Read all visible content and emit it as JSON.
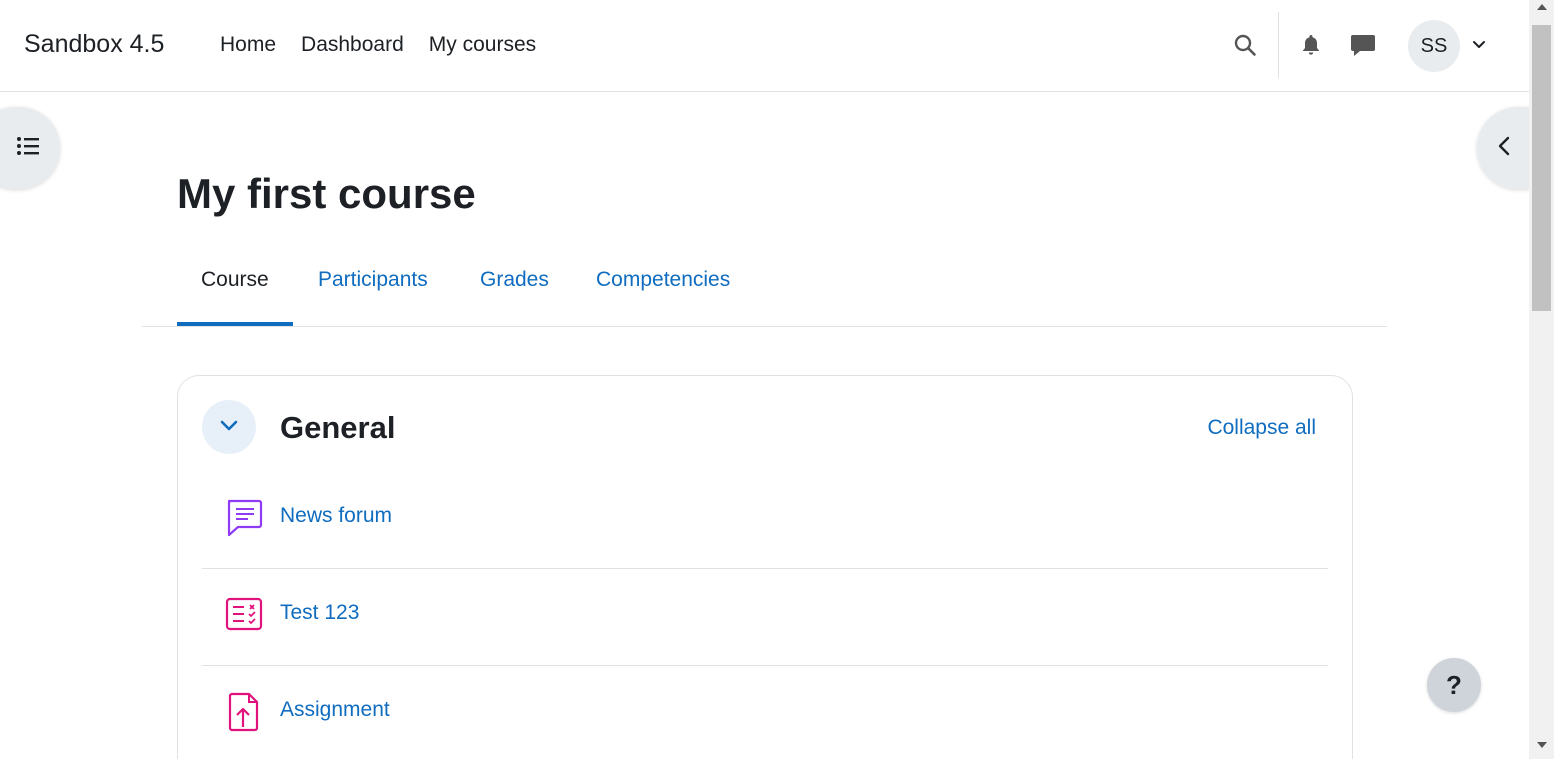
{
  "navbar": {
    "brand": "Sandbox 4.5",
    "links": [
      "Home",
      "Dashboard",
      "My courses"
    ],
    "user_initials": "SS",
    "icons": [
      "search-icon",
      "bell-icon",
      "message-icon",
      "chevron-down-icon"
    ]
  },
  "page": {
    "title": "My first course",
    "tabs": [
      "Course",
      "Participants",
      "Grades",
      "Competencies"
    ],
    "active_tab": "Course"
  },
  "section": {
    "title": "General",
    "collapse_all": "Collapse all",
    "activities": [
      {
        "name": "News forum",
        "icon": "forum-icon",
        "color": "#8f3bf5"
      },
      {
        "name": "Test 123",
        "icon": "quiz-icon",
        "color": "#e0137d"
      },
      {
        "name": "Assignment",
        "icon": "assignment-icon",
        "color": "#e0137d"
      }
    ]
  },
  "help": {
    "label": "?"
  },
  "colors": {
    "link": "#0f6cbf",
    "text": "#1d2125",
    "border": "#dee2e6"
  }
}
